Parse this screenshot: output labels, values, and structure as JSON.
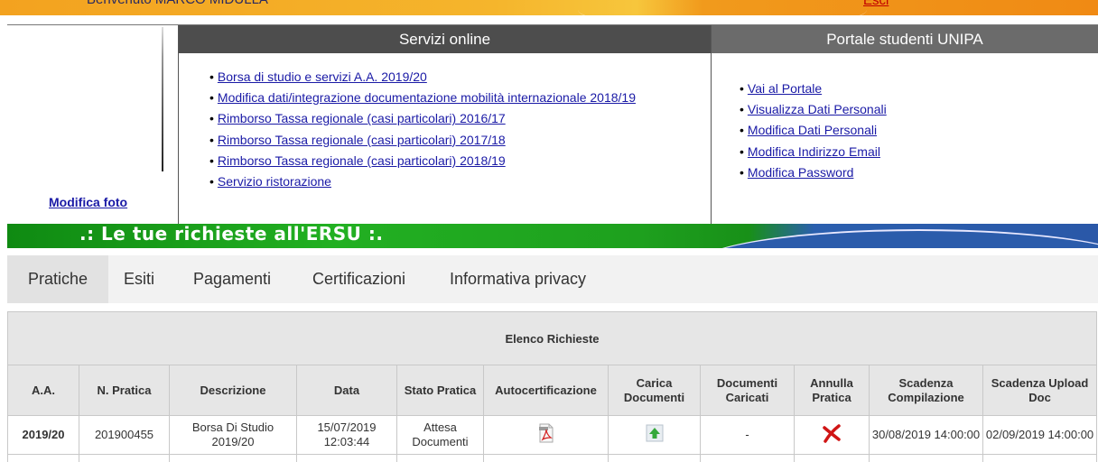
{
  "topbar": {
    "welcome": "Benvenuto MARCO MIDULLA",
    "logout": "Esci"
  },
  "photo": {
    "edit_link": "Modifica foto"
  },
  "services": {
    "title": "Servizi online",
    "links": [
      "Borsa di studio e servizi A.A. 2019/20",
      "Modifica dati/integrazione documentazione mobilità internazionale 2018/19",
      "Rimborso Tassa regionale (casi particolari) 2016/17",
      "Rimborso Tassa regionale (casi particolari) 2017/18",
      "Rimborso Tassa regionale (casi particolari) 2018/19",
      "Servizio ristorazione"
    ]
  },
  "portal": {
    "title": "Portale studenti UNIPA",
    "links": [
      "Vai al Portale",
      "Visualizza Dati Personali",
      "Modifica Dati Personali",
      "Modifica Indirizzo Email",
      "Modifica Password"
    ]
  },
  "banner": {
    "title": ".: Le tue richieste all'ERSU :."
  },
  "tabs": [
    {
      "label": "Pratiche",
      "active": true
    },
    {
      "label": "Esiti",
      "active": false
    },
    {
      "label": "Pagamenti",
      "active": false
    },
    {
      "label": "Certificazioni",
      "active": false
    },
    {
      "label": "Informativa privacy",
      "active": false
    }
  ],
  "table": {
    "caption": "Elenco Richieste",
    "columns": [
      "A.A.",
      "N. Pratica",
      "Descrizione",
      "Data",
      "Stato Pratica",
      "Autocertificazione",
      "Carica Documenti",
      "Documenti Caricati",
      "Annulla Pratica",
      "Scadenza Compilazione",
      "Scadenza Upload Doc"
    ],
    "rows": [
      {
        "aa": "2019/20",
        "numero": "201900455",
        "descrizione": "Borsa Di Studio 2019/20",
        "data": "15/07/2019 12:03:44",
        "stato": "Attesa Documenti",
        "autocertificazione_icon": "pdf-icon",
        "carica_icon": "upload-icon",
        "documenti_caricati": "-",
        "annulla_icon": "delete-x-icon",
        "scadenza_compilazione": "30/08/2019 14:00:00",
        "scadenza_upload": "02/09/2019 14:00:00"
      }
    ]
  },
  "colors": {
    "top_orange": "#f3a21f",
    "panel_dark": "#4d4d4d",
    "banner_green": "#1ea01e",
    "banner_blue": "#2b5cab",
    "link_blue": "#1a1aa6",
    "delete_red": "#d01515"
  }
}
